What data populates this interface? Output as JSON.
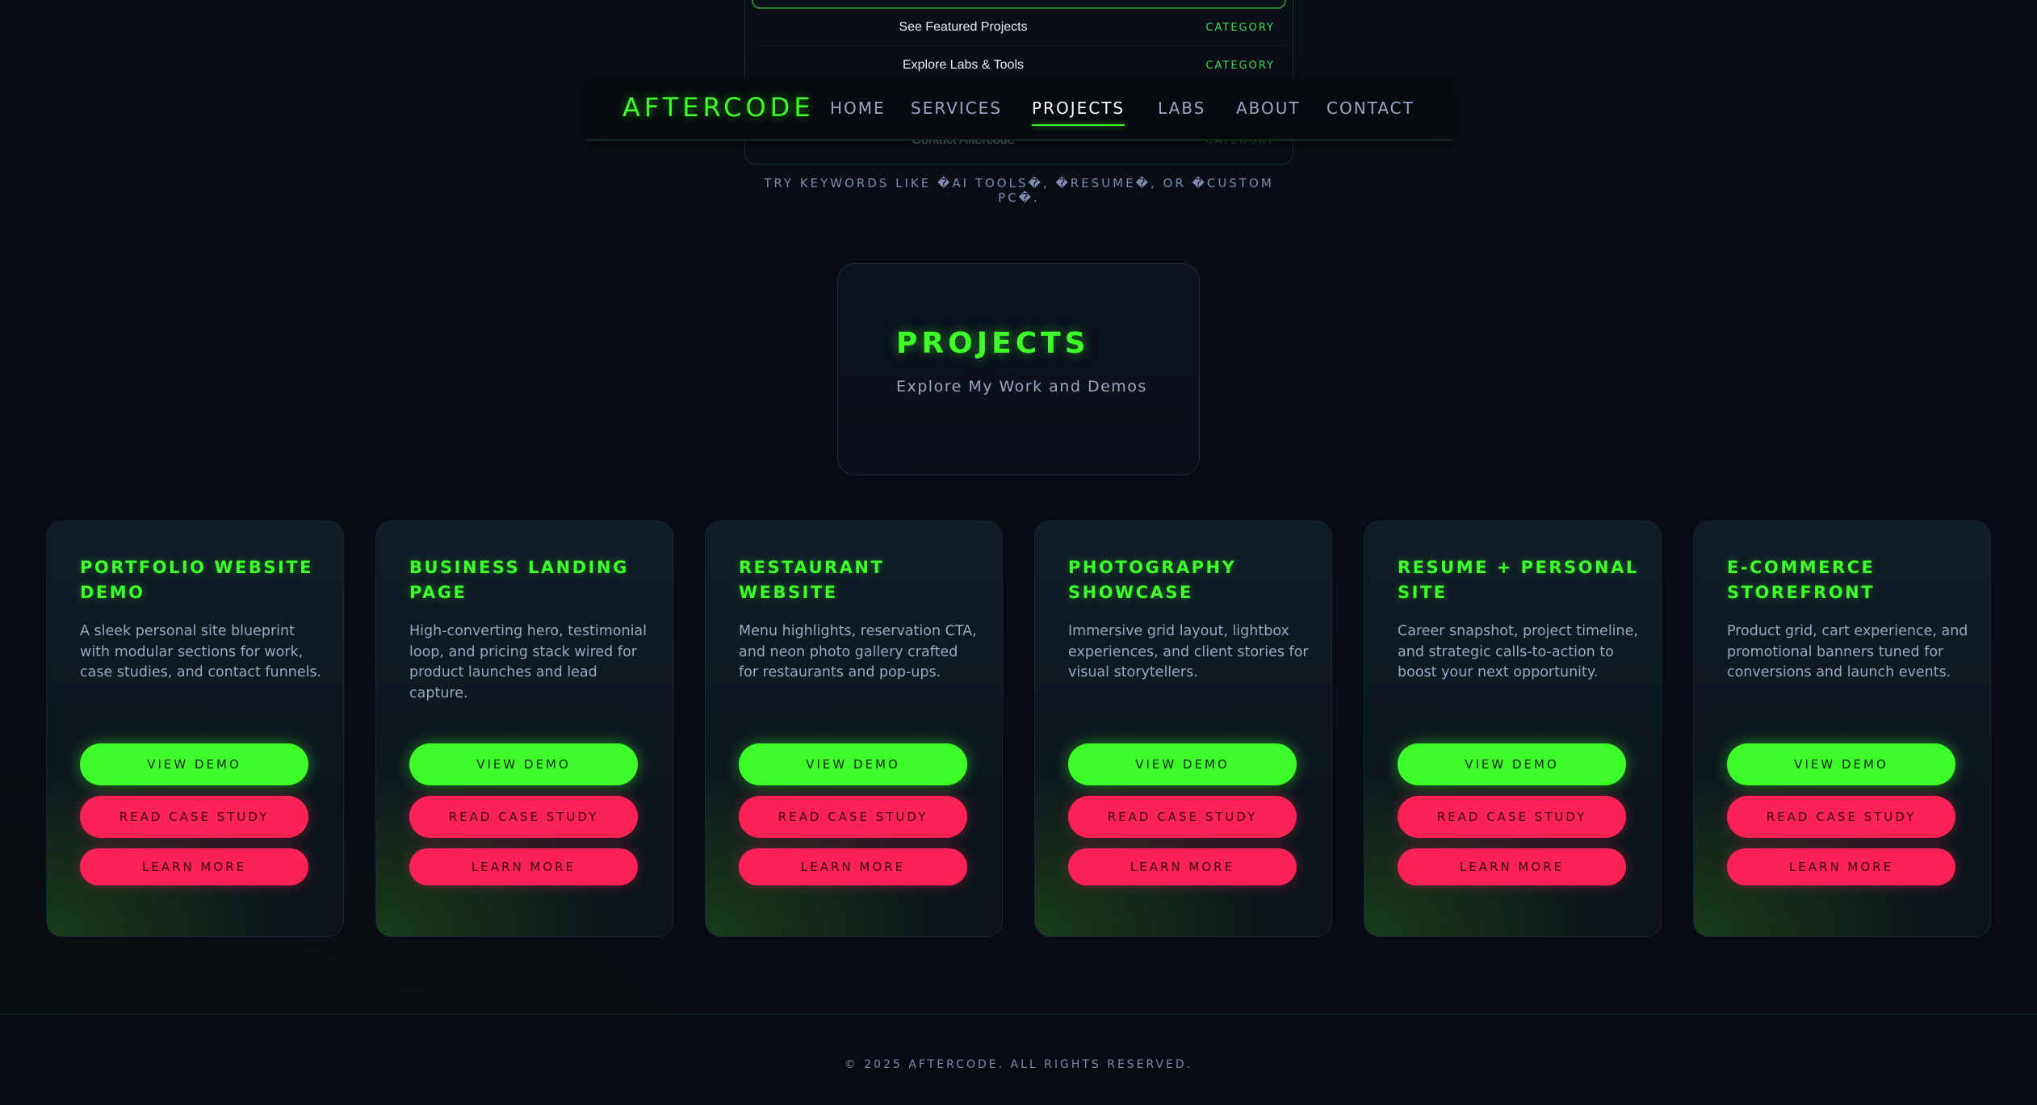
{
  "colors": {
    "accent_green": "#3dfc2a",
    "accent_pink": "#fb2255",
    "background": "#080b11",
    "muted_text": "#9aa6c4"
  },
  "search": {
    "suggestions": [
      {
        "label": "See Featured Projects",
        "category": "CATEGORY"
      },
      {
        "label": "Explore Labs & Tools",
        "category": "CATEGORY"
      },
      {
        "label": "Contact Aftercode",
        "category": "CATEGORY"
      }
    ],
    "hint": "TRY KEYWORDS LIKE �AI TOOLS�, �RESUME�, OR �CUSTOM PC�."
  },
  "nav": {
    "brand": "AFTERCODE",
    "items": [
      "HOME",
      "SERVICES",
      "PROJECTS",
      "LABS",
      "ABOUT",
      "CONTACT"
    ],
    "active": "PROJECTS"
  },
  "hero": {
    "title": "PROJECTS",
    "subtitle": "Explore My Work and Demos"
  },
  "button_labels": {
    "demo": "VIEW DEMO",
    "case": "READ CASE STUDY",
    "more": "LEARN MORE"
  },
  "projects": [
    {
      "title": "Portfolio Website Demo",
      "description": "A sleek personal site blueprint with modular sections for work, case studies, and contact funnels."
    },
    {
      "title": "Business Landing Page",
      "description": "High-converting hero, testimonial loop, and pricing stack wired for product launches and lead capture."
    },
    {
      "title": "Restaurant Website",
      "description": "Menu highlights, reservation CTA, and neon photo gallery crafted for restaurants and pop-ups."
    },
    {
      "title": "Photography Showcase",
      "description": "Immersive grid layout, lightbox experiences, and client stories for visual storytellers."
    },
    {
      "title": "Resume + Personal Site",
      "description": "Career snapshot, project timeline, and strategic calls-to-action to boost your next opportunity."
    },
    {
      "title": "E-Commerce Storefront",
      "description": "Product grid, cart experience, and promotional banners tuned for conversions and launch events."
    }
  ],
  "footer": {
    "copyright": "© 2025 AFTERCODE. ALL RIGHTS RESERVED."
  }
}
